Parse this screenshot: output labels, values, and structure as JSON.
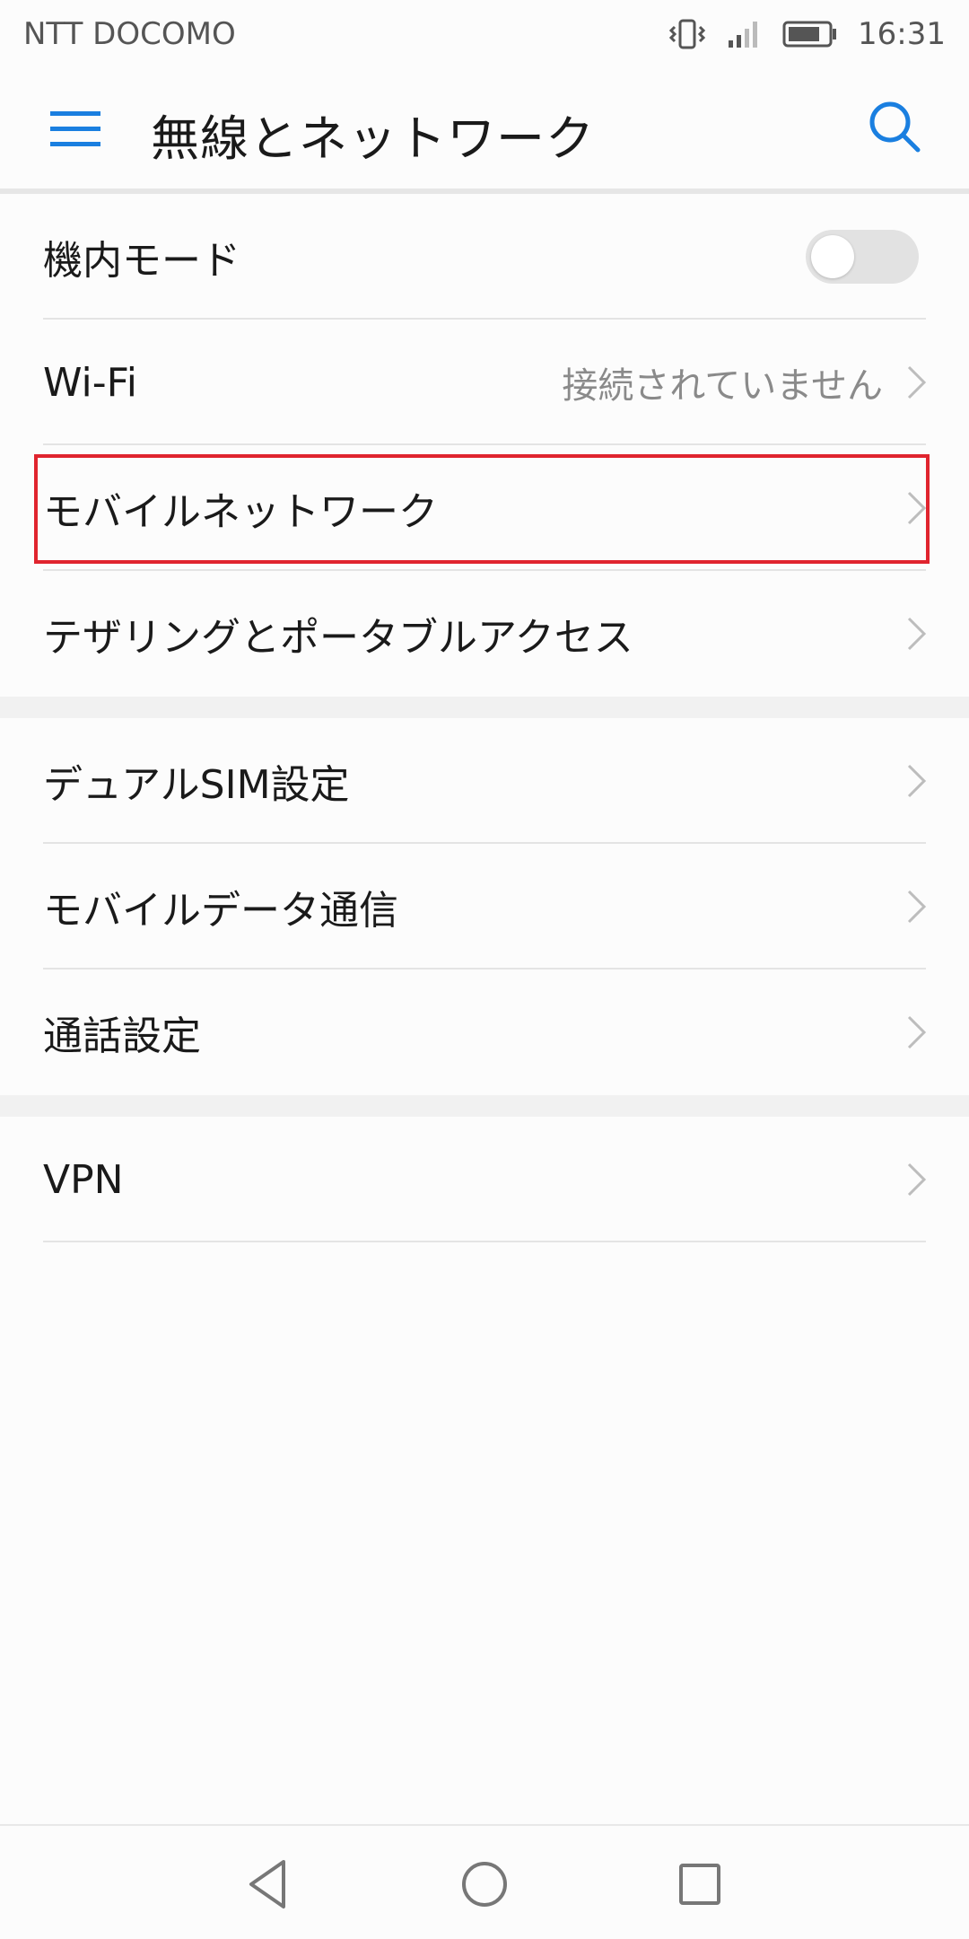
{
  "status_bar": {
    "carrier": "NTT DOCOMO",
    "time": "16:31",
    "icons": [
      "vibrate-icon",
      "signal-icon",
      "battery-icon"
    ]
  },
  "app_bar": {
    "title": "無線とネットワーク",
    "menu_icon": "menu-icon",
    "search_icon": "search-icon",
    "accent_color": "#1a7fe0"
  },
  "sections": [
    {
      "items": [
        {
          "label": "機内モード",
          "control": "toggle",
          "toggle_on": false
        },
        {
          "label": "Wi-Fi",
          "value": "接続されていません",
          "control": "chevron"
        },
        {
          "label": "モバイルネットワーク",
          "control": "chevron",
          "highlighted": true
        },
        {
          "label": "テザリングとポータブルアクセス",
          "control": "chevron"
        }
      ]
    },
    {
      "items": [
        {
          "label": "デュアルSIM設定",
          "control": "chevron"
        },
        {
          "label": "モバイルデータ通信",
          "control": "chevron"
        },
        {
          "label": "通話設定",
          "control": "chevron"
        }
      ]
    },
    {
      "items": [
        {
          "label": "VPN",
          "control": "chevron"
        }
      ]
    }
  ],
  "highlight_color": "#e0242e",
  "nav_bar": {
    "icons": [
      "back-icon",
      "home-icon",
      "recents-icon"
    ]
  }
}
